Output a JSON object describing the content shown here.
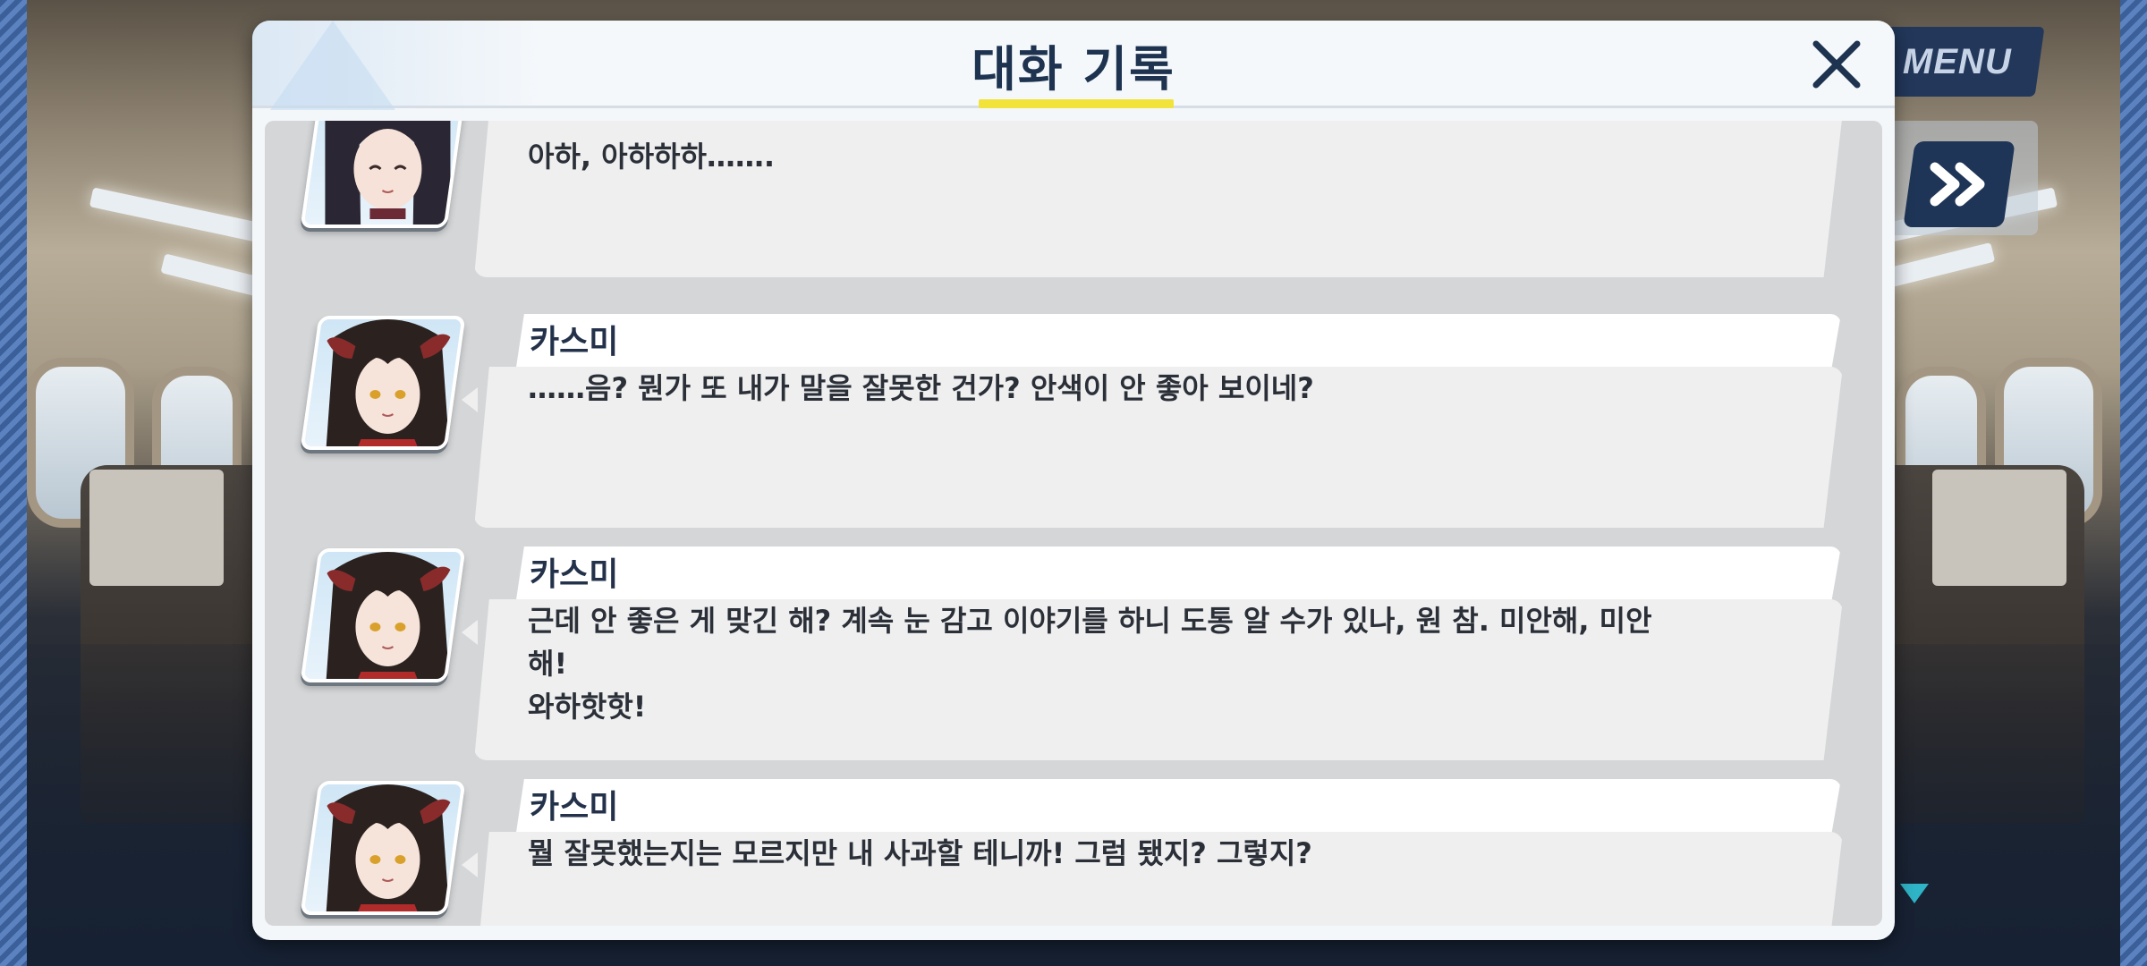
{
  "dialog": {
    "title": "대화 기록",
    "close_icon": "close-icon"
  },
  "game_ui": {
    "menu_label": "MENU",
    "fast_forward_icon": "fast-forward-icon",
    "scroll_down_icon": "triangle-down-icon"
  },
  "log": [
    {
      "speaker": "",
      "portrait": "portrait-long-dark-hair-eyes-closed",
      "text": "아하, 아하하하……."
    },
    {
      "speaker": "카스미",
      "portrait": "portrait-kasumi",
      "text": "……음? 뭔가 또 내가 말을 잘못한 건가? 안색이 안 좋아 보이네?"
    },
    {
      "speaker": "카스미",
      "portrait": "portrait-kasumi",
      "text": "근데 안 좋은 게 맞긴 해? 계속 눈 감고 이야기를 하니 도통 알 수가 있나, 원 참. 미안해, 미안해!\n와하핫핫!"
    },
    {
      "speaker": "카스미",
      "portrait": "portrait-kasumi",
      "text": "뭘 잘못했는지는 모르지만 내 사과할 테니까! 그럼 됐지? 그렇지?"
    }
  ],
  "colors": {
    "title": "#1e3350",
    "title_underline": "#f2e33a",
    "menu_button": "#22375a",
    "log_background": "#d4d6d8",
    "bubble": "#efefef",
    "scroll_arrow": "#2fb3c6"
  }
}
